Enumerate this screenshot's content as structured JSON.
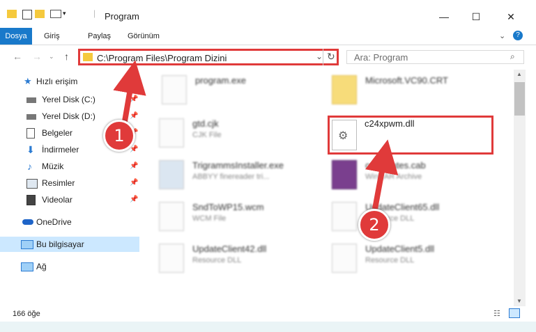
{
  "window": {
    "title": "Program"
  },
  "ribbon": {
    "tabs": [
      "Dosya",
      "Giriş",
      "Paylaş",
      "Görünüm"
    ]
  },
  "address": {
    "path": "C:\\Program Files\\Program Dizini"
  },
  "search": {
    "placeholder": "Ara: Program"
  },
  "sidebar": {
    "items": [
      {
        "label": "Hızlı erişim"
      },
      {
        "label": "Yerel Disk (C:)"
      },
      {
        "label": "Yerel Disk (D:)"
      },
      {
        "label": "Belgeler"
      },
      {
        "label": "İndirmeler"
      },
      {
        "label": "Müzik"
      },
      {
        "label": "Resimler"
      },
      {
        "label": "Videolar"
      },
      {
        "label": "OneDrive"
      },
      {
        "label": "Bu bilgisayar"
      },
      {
        "label": "Ağ"
      }
    ]
  },
  "files": [
    {
      "name": "program.exe",
      "type": ""
    },
    {
      "name": "Microsoft.VC90.CRT",
      "type": ""
    },
    {
      "name": "gtd.cjk",
      "type": "CJK File"
    },
    {
      "name": "c24xpwm.dll",
      "type": ""
    },
    {
      "name": "TrigrammsInstaller.exe",
      "type": "ABBYY finereader tri..."
    },
    {
      "name": "certificates.cab",
      "type": "WinRAR Archive"
    },
    {
      "name": "SndToWP15.wcm",
      "type": "WCM File"
    },
    {
      "name": "UpdateClient65.dll",
      "type": "Resource DLL"
    },
    {
      "name": "UpdateClient42.dll",
      "type": "Resource DLL"
    },
    {
      "name": "UpdateClient5.dll",
      "type": "Resource DLL"
    }
  ],
  "status": {
    "count": "166 öğe"
  },
  "annotations": {
    "step1": "1",
    "step2": "2"
  },
  "colors": {
    "accent": "#1979ca",
    "highlight": "#e03a3a"
  }
}
